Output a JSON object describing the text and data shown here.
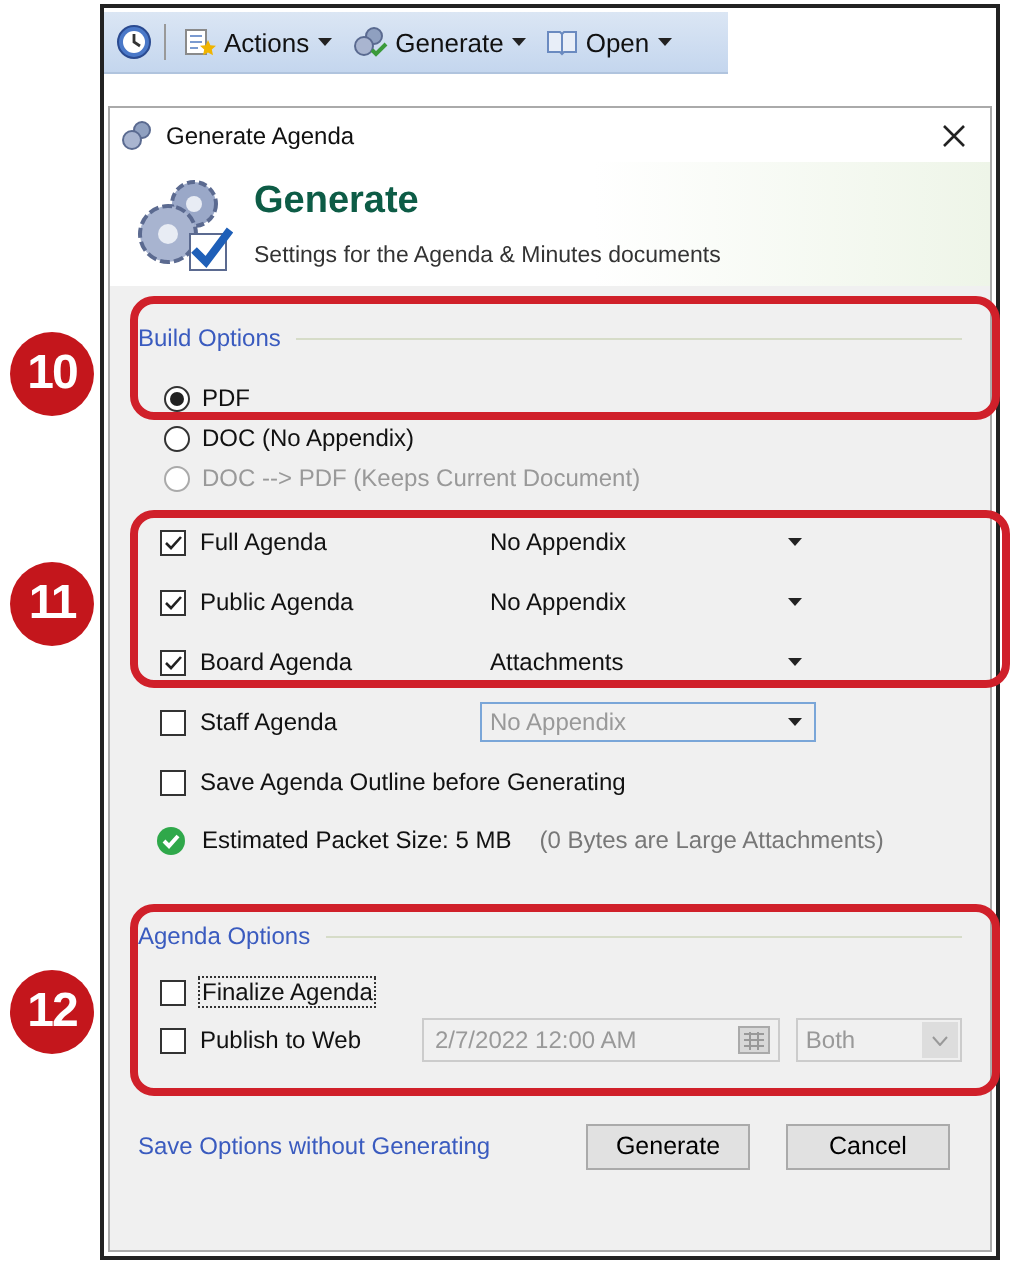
{
  "toolbar": {
    "items": [
      {
        "label": "Actions",
        "kind": "actions"
      },
      {
        "label": "Generate",
        "kind": "generate"
      },
      {
        "label": "Open",
        "kind": "open"
      }
    ]
  },
  "dialog": {
    "title": "Generate Agenda"
  },
  "header": {
    "title": "Generate",
    "subtitle": "Settings for the Agenda & Minutes documents"
  },
  "build_options": {
    "label": "Build Options",
    "options": [
      {
        "label": "PDF",
        "selected": true,
        "disabled": false
      },
      {
        "label": "DOC (No Appendix)",
        "selected": false,
        "disabled": false
      },
      {
        "label": "DOC --> PDF (Keeps Current Document)",
        "selected": false,
        "disabled": true
      }
    ]
  },
  "agendas": [
    {
      "label": "Full Agenda",
      "checked": true,
      "appendix": "No Appendix",
      "disabled": false
    },
    {
      "label": "Public Agenda",
      "checked": true,
      "appendix": "No Appendix",
      "disabled": false
    },
    {
      "label": "Board Agenda",
      "checked": true,
      "appendix": "Attachments",
      "disabled": false
    },
    {
      "label": "Staff Agenda",
      "checked": false,
      "appendix": "No Appendix",
      "disabled": true
    }
  ],
  "save_outline": {
    "label": "Save Agenda Outline before Generating",
    "checked": false
  },
  "estimate": {
    "label": "Estimated Packet Size: 5 MB",
    "note": "(0 Bytes are Large Attachments)"
  },
  "agenda_options": {
    "label": "Agenda Options",
    "finalize": {
      "label": "Finalize Agenda",
      "checked": false
    },
    "publish": {
      "label": "Publish to Web",
      "checked": false,
      "date": "2/7/2022 12:00 AM",
      "target": "Both"
    }
  },
  "link": "Save Options without Generating",
  "buttons": [
    "Generate",
    "Cancel"
  ],
  "callouts": [
    "10",
    "11",
    "12"
  ]
}
